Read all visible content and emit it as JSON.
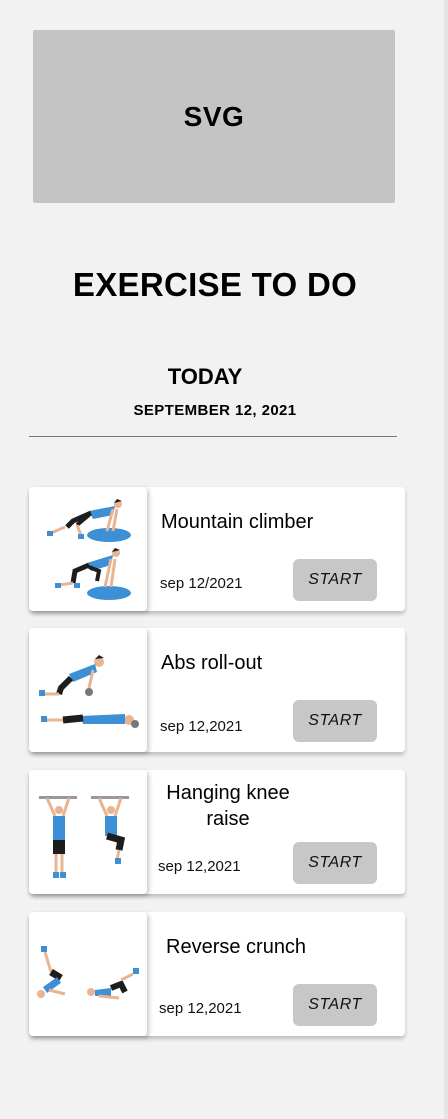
{
  "banner": {
    "label": "SVG"
  },
  "header": {
    "title": "EXERCISE TO DO",
    "day": "TODAY",
    "date": "SEPTEMBER 12, 2021"
  },
  "exercises": [
    {
      "name": "Mountain climber",
      "date": "sep 12/2021",
      "start_label": "START",
      "image": "mountain-climber-illustration"
    },
    {
      "name": "Abs roll-out",
      "date": "sep 12,2021",
      "start_label": "START",
      "image": "abs-rollout-illustration"
    },
    {
      "name": "Hanging knee raise",
      "date": "sep 12,2021",
      "start_label": "START",
      "image": "hanging-knee-raise-illustration"
    },
    {
      "name": "Reverse crunch",
      "date": "sep 12,2021",
      "start_label": "START",
      "image": "reverse-crunch-illustration"
    }
  ],
  "colors": {
    "background": "#f2f2f2",
    "banner": "#c4c4c4",
    "button": "#c7c7c7",
    "card": "#ffffff",
    "figure_blue": "#3d8fd6",
    "figure_skin": "#e9b48f",
    "figure_dark": "#1d1d1d"
  }
}
